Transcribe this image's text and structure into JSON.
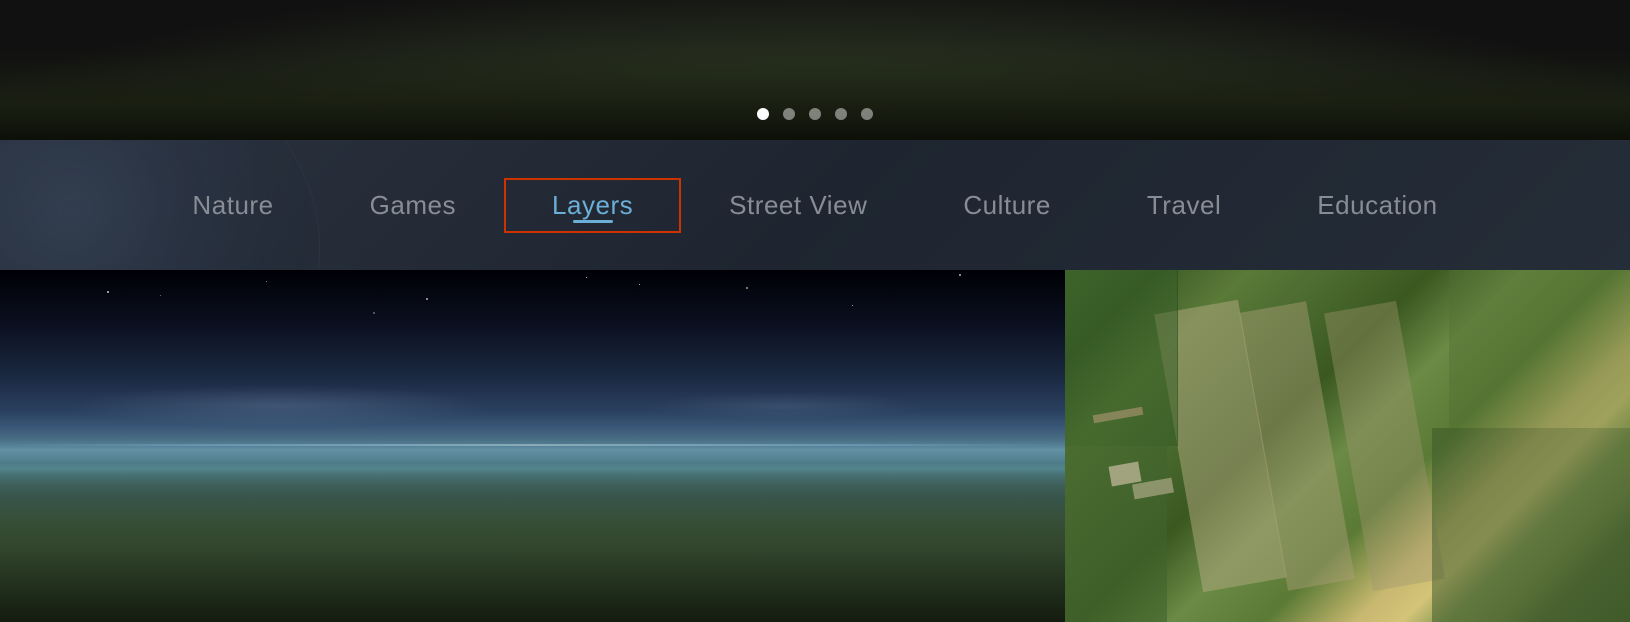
{
  "hero": {
    "carousel": {
      "dots": [
        {
          "id": "dot-1",
          "active": true
        },
        {
          "id": "dot-2",
          "active": false
        },
        {
          "id": "dot-3",
          "active": false
        },
        {
          "id": "dot-4",
          "active": false
        },
        {
          "id": "dot-5",
          "active": false
        }
      ]
    }
  },
  "nav": {
    "items": [
      {
        "id": "nature",
        "label": "Nature",
        "active": false
      },
      {
        "id": "games",
        "label": "Games",
        "active": false
      },
      {
        "id": "layers",
        "label": "Layers",
        "active": true
      },
      {
        "id": "street-view",
        "label": "Street View",
        "active": false
      },
      {
        "id": "culture",
        "label": "Culture",
        "active": false
      },
      {
        "id": "travel",
        "label": "Travel",
        "active": false
      },
      {
        "id": "education",
        "label": "Education",
        "active": false
      }
    ]
  },
  "colors": {
    "active_tab_text": "#6baed6",
    "active_tab_border": "#cc3300",
    "inactive_tab_text": "#888c95",
    "nav_bg": "#252d38",
    "dot_active": "#ffffff",
    "dot_inactive": "rgba(255,255,255,0.45)"
  }
}
